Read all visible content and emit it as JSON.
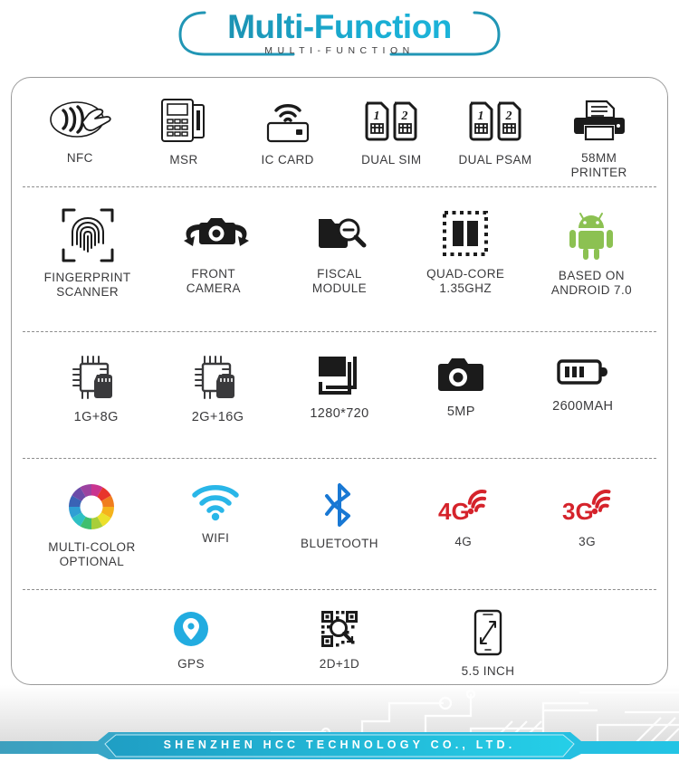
{
  "header": {
    "title": "Multi-Function",
    "subtitle": "MULTI-FUNCTION",
    "accent_color": "#19aed4",
    "title_gradient_from": "#1f6f86",
    "title_gradient_to": "#28c4e8"
  },
  "features": {
    "rows": [
      {
        "items": [
          {
            "icon": "nfc-icon",
            "label": "NFC"
          },
          {
            "icon": "msr-terminal-icon",
            "label": "MSR"
          },
          {
            "icon": "ic-card-icon",
            "label": "IC CARD"
          },
          {
            "icon": "dual-sim-icon",
            "label": "DUAL SIM",
            "badges": [
              "1",
              "2"
            ]
          },
          {
            "icon": "dual-psam-icon",
            "label": "DUAL PSAM",
            "badges": [
              "1",
              "2"
            ]
          },
          {
            "icon": "printer-icon",
            "label": "58MM\nPRINTER"
          }
        ]
      },
      {
        "items": [
          {
            "icon": "fingerprint-scanner-icon",
            "label": "FINGERPRINT\nSCANNER"
          },
          {
            "icon": "front-camera-icon",
            "label": "FRONT\nCAMERA"
          },
          {
            "icon": "fiscal-module-icon",
            "label": "FISCAL\nMODULE"
          },
          {
            "icon": "quad-core-chip-icon",
            "label": "QUAD-CORE\n1.35GHZ"
          },
          {
            "icon": "android-robot-icon",
            "label": "BASED ON\nANDROID 7.0",
            "color": "#8cc152"
          }
        ]
      },
      {
        "items": [
          {
            "icon": "memory-chip-icon",
            "label": "1G+8G"
          },
          {
            "icon": "memory-chip-icon",
            "label": "2G+16G"
          },
          {
            "icon": "resolution-icon",
            "label": "1280*720"
          },
          {
            "icon": "camera-icon",
            "label": "5MP"
          },
          {
            "icon": "battery-icon",
            "label": "2600MAH"
          }
        ]
      },
      {
        "items": [
          {
            "icon": "color-wheel-icon",
            "label": "MULTI-COLOR\nOPTIONAL"
          },
          {
            "icon": "wifi-icon",
            "label": "WIFI",
            "color": "#29b6e8"
          },
          {
            "icon": "bluetooth-icon",
            "label": "BLUETOOTH",
            "color": "#1878d4"
          },
          {
            "icon": "network-4g-icon",
            "label": "4G",
            "badge_text": "4G",
            "color": "#d5232b"
          },
          {
            "icon": "network-3g-icon",
            "label": "3G",
            "badge_text": "3G",
            "color": "#d5232b"
          }
        ]
      },
      {
        "items": [
          {
            "icon": "gps-pin-icon",
            "label": "GPS",
            "color": "#22ace0"
          },
          {
            "icon": "qr-scanner-icon",
            "label": "2D+1D"
          },
          {
            "icon": "screen-size-icon",
            "label": "5.5 INCH"
          }
        ]
      }
    ]
  },
  "footer": {
    "company": "SHENZHEN HCC TECHNOLOGY CO., LTD.",
    "bar_color_left": "#3d9fbe",
    "bar_color_right": "#23c4e4"
  },
  "colors": {
    "label": "#3a3a3c",
    "icon_dark": "#1b1b1b",
    "card_border": "#9a9a9a",
    "divider": "#8d8d8d"
  }
}
